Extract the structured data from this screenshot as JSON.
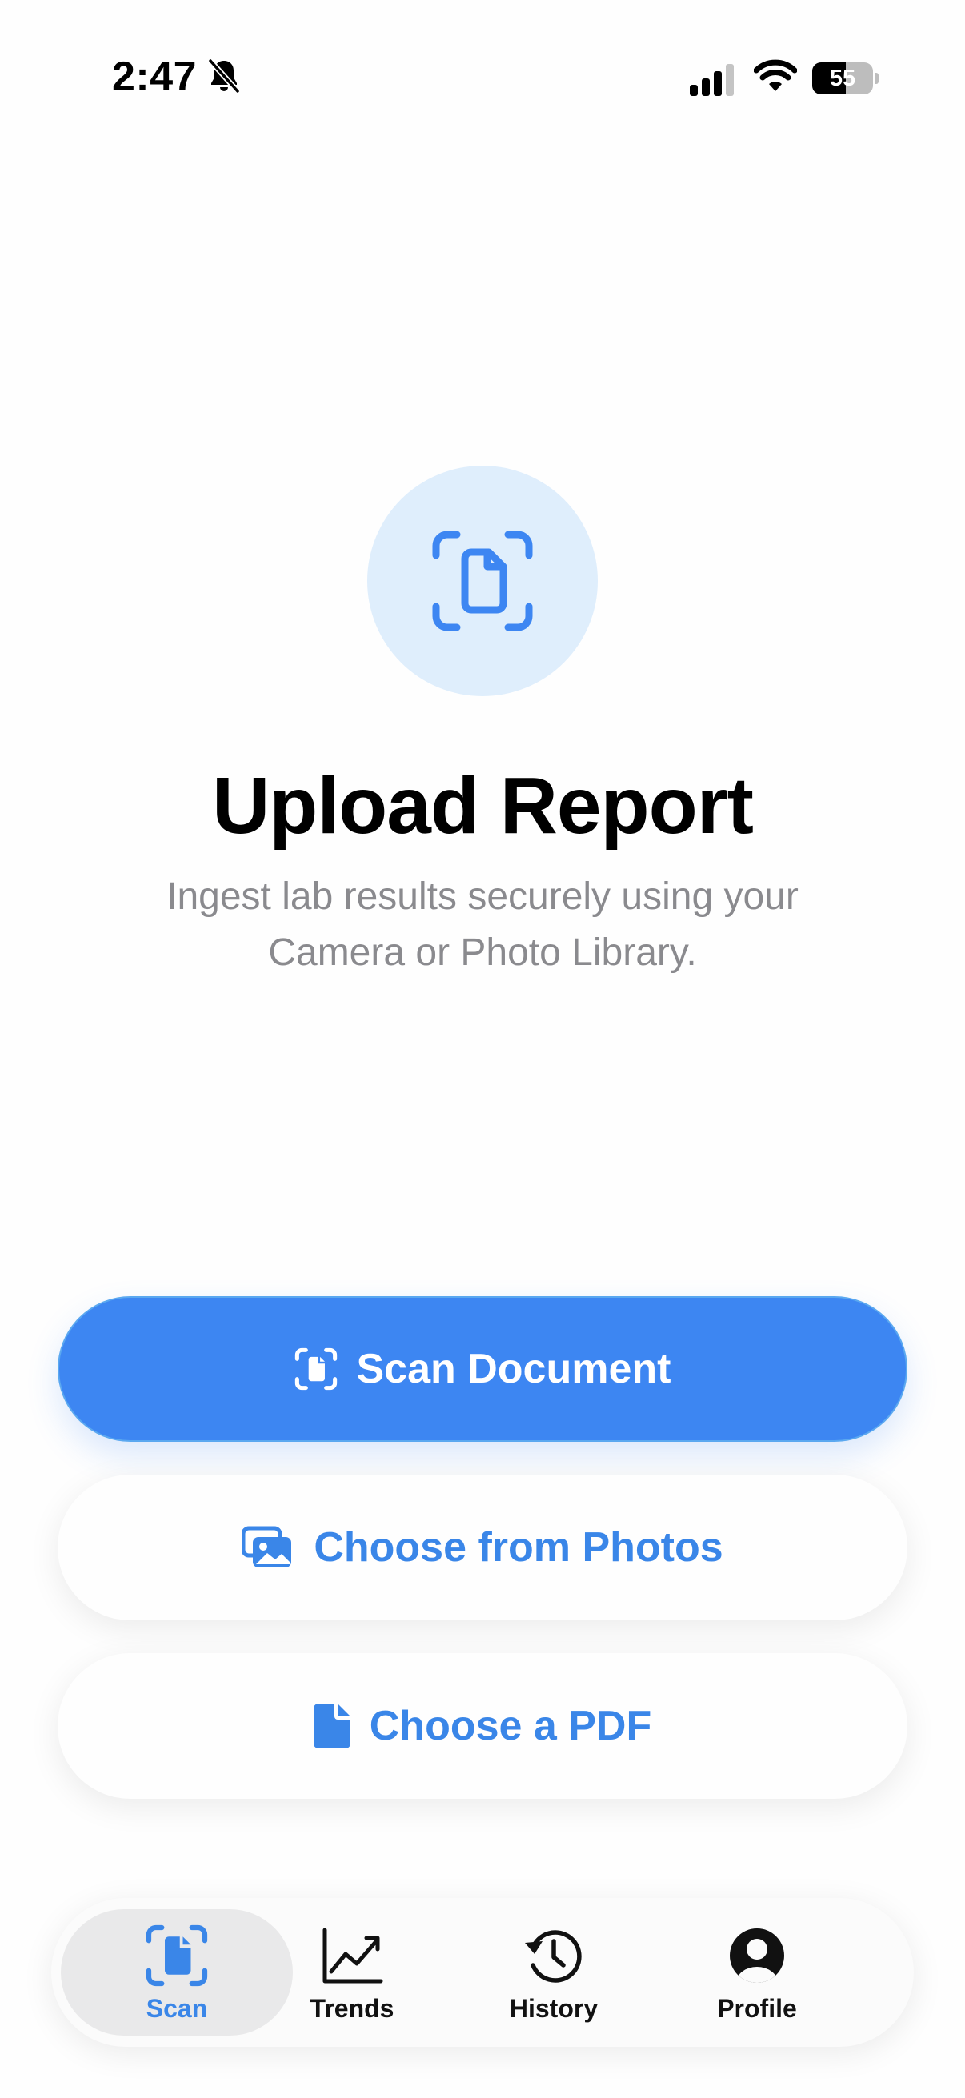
{
  "status_bar": {
    "time": "2:47",
    "battery": "55",
    "battery_level_percent": 55,
    "icons": [
      "bell-slash-icon",
      "cellular-signal-icon",
      "wifi-icon",
      "battery-icon"
    ]
  },
  "hero": {
    "icon": "document-scan-icon",
    "title": "Upload Report",
    "subtitle": "Ingest lab results securely using your Camera or Photo Library."
  },
  "actions": {
    "scan_label": "Scan Document",
    "scan_icon": "document-scan-icon",
    "photos_label": "Choose from Photos",
    "photos_icon": "photo-stack-icon",
    "pdf_label": "Choose a PDF",
    "pdf_icon": "document-icon"
  },
  "tab_bar": {
    "active": "Scan",
    "items": [
      {
        "label": "Scan",
        "icon": "document-scan-icon"
      },
      {
        "label": "Trends",
        "icon": "chart-trend-icon"
      },
      {
        "label": "History",
        "icon": "clock-history-icon"
      },
      {
        "label": "Profile",
        "icon": "person-circle-icon"
      }
    ]
  },
  "colors": {
    "accent": "#3d86f2",
    "accent_text": "#3a86e8",
    "hero_circle": "#dfeefc",
    "subtitle": "#8a8a8e",
    "active_tab_bg": "#e9e9ea"
  }
}
